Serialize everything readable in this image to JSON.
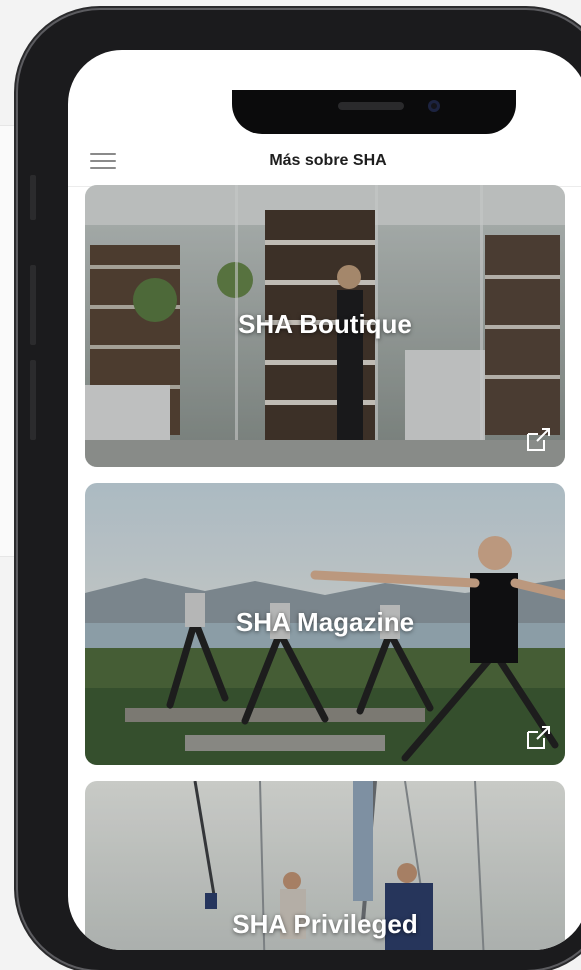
{
  "header": {
    "title": "Más sobre SHA",
    "menu_icon": "hamburger-menu-icon"
  },
  "cards": [
    {
      "title": "SHA Boutique",
      "icon": "external-link-icon"
    },
    {
      "title": "SHA Magazine",
      "icon": "external-link-icon"
    },
    {
      "title": "SHA Privileged"
    }
  ]
}
